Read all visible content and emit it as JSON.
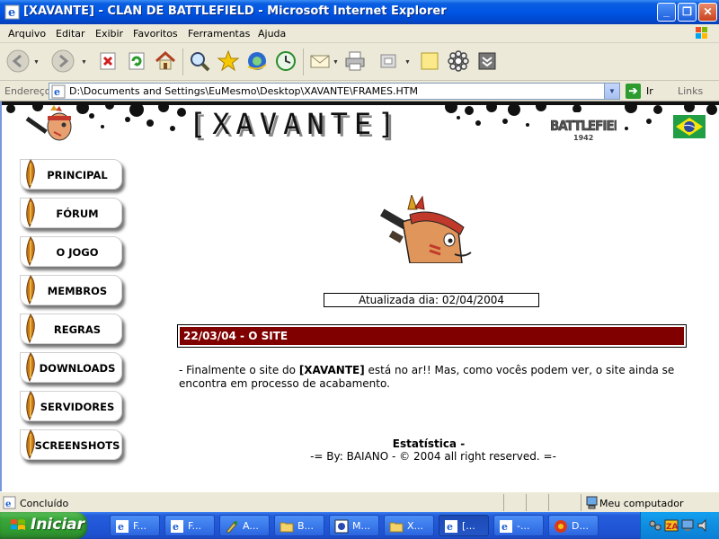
{
  "window": {
    "title": "[XAVANTE] - CLAN DE BATTLEFIELD - Microsoft Internet Explorer",
    "buttons": {
      "minimize": "_",
      "maximize": "❐",
      "close": "✕"
    }
  },
  "menu": [
    "Arquivo",
    "Editar",
    "Exibir",
    "Favoritos",
    "Ferramentas",
    "Ajuda"
  ],
  "toolbar": {
    "icons": [
      "back-icon",
      "forward-icon",
      "stop-icon",
      "refresh-icon",
      "home-icon",
      "search-icon",
      "favorites-icon",
      "media-icon",
      "history-icon",
      "mail-icon",
      "print-icon",
      "edit-icon",
      "discuss-icon",
      "research-icon",
      "messenger-icon"
    ]
  },
  "address": {
    "label": "Endereço",
    "url": "D:\\Documents and Settings\\EuMesmo\\Desktop\\XAVANTE\\FRAMES.HTM",
    "go_label": "Ir",
    "links_label": "Links"
  },
  "site": {
    "title": "[XAVANTE]",
    "nav": [
      "PRINCIPAL",
      "FÓRUM",
      "O JOGO",
      "MEMBROS",
      "REGRAS",
      "DOWNLOADS",
      "SERVIDORES",
      "SCREENSHOTS"
    ],
    "updated": "Atualizada dia: 02/04/2004",
    "news_title": "22/03/04 - O SITE",
    "news_text_before": "- Finalmente o site do ",
    "news_text_bold": "[XAVANTE]",
    "news_text_after": " está no ar!! Mas, como vocês podem ver, o site ainda se encontra em processo de acabamento.",
    "stats_label": "Estatística -",
    "footer": "-= By: BAIANO - © 2004 all right reserved. =-"
  },
  "status": {
    "text": "Concluído",
    "zone": "Meu computador"
  },
  "taskbar": {
    "start_label": "Iniciar",
    "tasks": [
      {
        "label": "F...",
        "icon": "ie-icon"
      },
      {
        "label": "F...",
        "icon": "ie-icon"
      },
      {
        "label": "A...",
        "icon": "paint-icon"
      },
      {
        "label": "B...",
        "icon": "folder-icon"
      },
      {
        "label": "M...",
        "icon": "app-icon"
      },
      {
        "label": "X...",
        "icon": "folder-icon"
      },
      {
        "label": "[...",
        "icon": "ie-icon"
      },
      {
        "label": "-...",
        "icon": "ie-icon"
      },
      {
        "label": "D...",
        "icon": "media-icon"
      }
    ]
  },
  "colors": {
    "news_bar": "#800000",
    "titlebar": "#0055e5",
    "taskbar": "#245edb",
    "start": "#3ba63b"
  }
}
